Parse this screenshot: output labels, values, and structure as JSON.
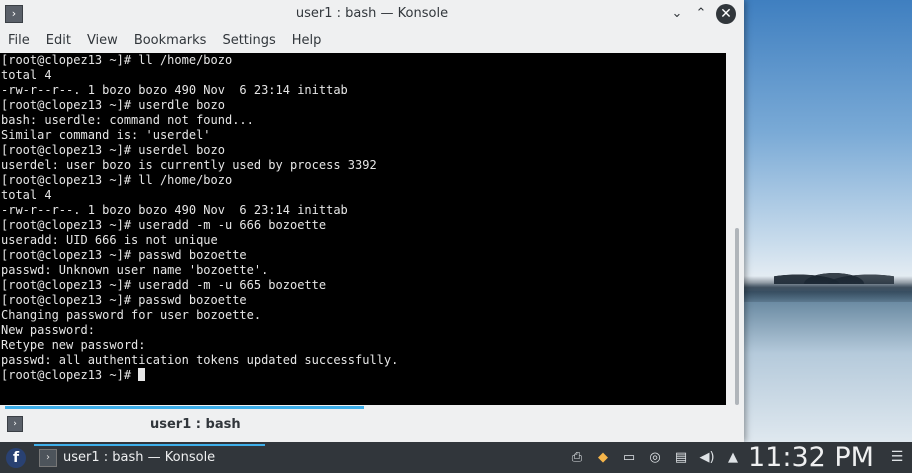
{
  "window": {
    "title": "user1 : bash — Konsole",
    "controls": {
      "minimize": "⌄",
      "maximize": "⌃",
      "close": "✕"
    }
  },
  "menubar": [
    "File",
    "Edit",
    "View",
    "Bookmarks",
    "Settings",
    "Help"
  ],
  "terminal": {
    "lines": [
      "[root@clopez13 ~]# ll /home/bozo",
      "total 4",
      "-rw-r--r--. 1 bozo bozo 490 Nov  6 23:14 inittab",
      "[root@clopez13 ~]# userdle bozo",
      "bash: userdle: command not found...",
      "Similar command is: 'userdel'",
      "[root@clopez13 ~]# userdel bozo",
      "userdel: user bozo is currently used by process 3392",
      "[root@clopez13 ~]# ll /home/bozo",
      "total 4",
      "-rw-r--r--. 1 bozo bozo 490 Nov  6 23:14 inittab",
      "[root@clopez13 ~]# useradd -m -u 666 bozoette",
      "useradd: UID 666 is not unique",
      "[root@clopez13 ~]# passwd bozoette",
      "passwd: Unknown user name 'bozoette'.",
      "[root@clopez13 ~]# useradd -m -u 665 bozoette",
      "[root@clopez13 ~]# passwd bozoette",
      "Changing password for user bozoette.",
      "New password:",
      "Retype new password:",
      "passwd: all authentication tokens updated successfully."
    ],
    "prompt": "[root@clopez13 ~]# "
  },
  "tab": {
    "label": "user1 : bash"
  },
  "taskbar": {
    "task_label": "user1 : bash — Konsole",
    "clock": "11:32 PM",
    "tray_icons": [
      "printer-icon",
      "package-updates-icon",
      "display-icon",
      "network-icon",
      "clipboard-icon",
      "volume-icon",
      "expand-tray-icon"
    ]
  },
  "colors": {
    "accent": "#3daee9",
    "terminal_bg": "#000000",
    "panel_bg": "#31363b"
  }
}
